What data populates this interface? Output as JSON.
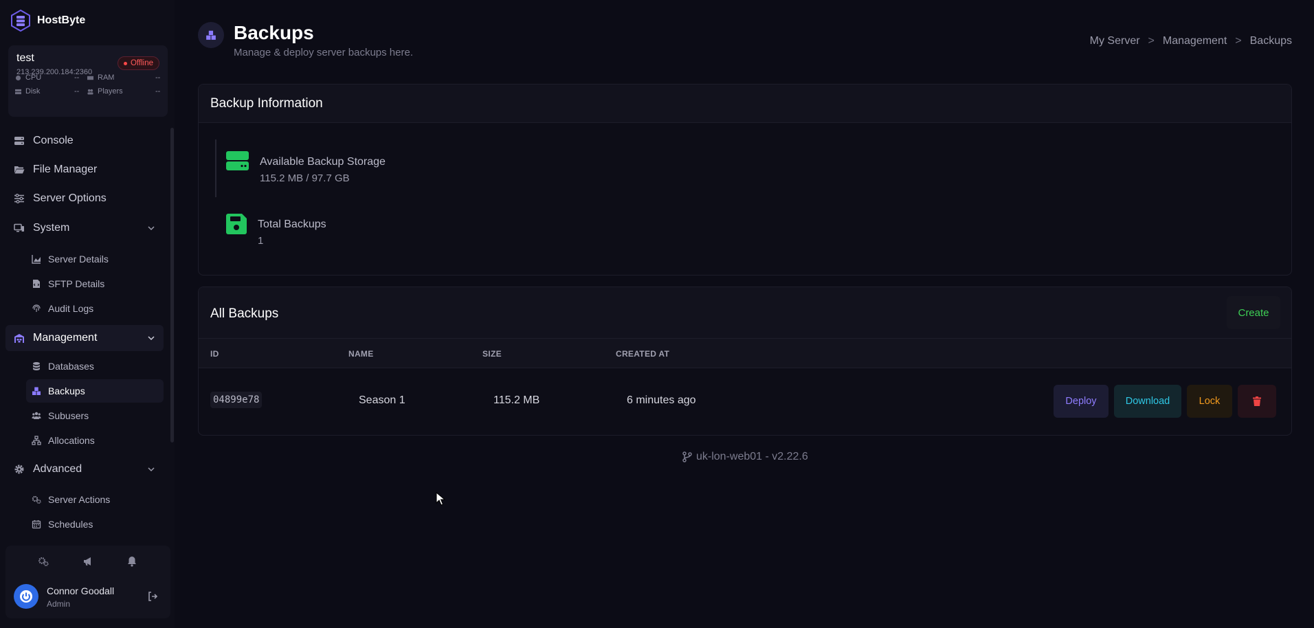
{
  "brand": {
    "name": "HostByte"
  },
  "server": {
    "name": "test",
    "ip": "213.239.200.184:2360",
    "status": "Offline",
    "stats": [
      {
        "label": "CPU",
        "value": "--",
        "icon": "cpu-icon"
      },
      {
        "label": "RAM",
        "value": "--",
        "icon": "memory-icon"
      },
      {
        "label": "Disk",
        "value": "--",
        "icon": "disk-icon"
      },
      {
        "label": "Players",
        "value": "--",
        "icon": "players-icon"
      }
    ]
  },
  "nav": {
    "console": "Console",
    "file_manager": "File Manager",
    "server_options": "Server Options",
    "system": "System",
    "system_items": [
      "Server Details",
      "SFTP Details",
      "Audit Logs"
    ],
    "management": "Management",
    "management_items": [
      "Databases",
      "Backups",
      "Subusers",
      "Allocations"
    ],
    "advanced": "Advanced",
    "advanced_items": [
      "Server Actions",
      "Schedules"
    ]
  },
  "user": {
    "name": "Connor Goodall",
    "role": "Admin"
  },
  "page": {
    "title": "Backups",
    "subtitle": "Manage & deploy server backups here.",
    "breadcrumb": [
      "My Server",
      "Management",
      "Backups"
    ],
    "breadcrumb_sep": ">"
  },
  "backup_info": {
    "title": "Backup Information",
    "storage_label": "Available Backup Storage",
    "storage_value": "115.2 MB / 97.7 GB",
    "total_label": "Total Backups",
    "total_value": "1"
  },
  "all_backups": {
    "title": "All Backups",
    "create_label": "Create",
    "columns": [
      "ID",
      "NAME",
      "SIZE",
      "CREATED AT"
    ],
    "rows": [
      {
        "id": "04899e78",
        "name": "Season 1",
        "size": "115.2 MB",
        "created_at": "6 minutes ago"
      }
    ],
    "actions": {
      "deploy": "Deploy",
      "download": "Download",
      "lock": "Lock",
      "delete_icon": "trash-icon"
    }
  },
  "footer": {
    "version": "uk-lon-web01 - v2.22.6"
  },
  "colors": {
    "accent": "#7b6cff",
    "success": "#22c55e",
    "danger": "#ef4444",
    "warning": "#f29a1e",
    "info": "#2fc8e6"
  }
}
